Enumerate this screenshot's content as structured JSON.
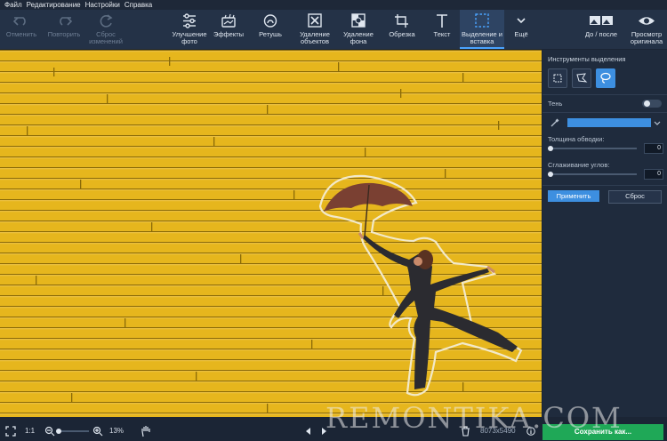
{
  "menu": [
    "Файл",
    "Редактирование",
    "Настройки",
    "Справка"
  ],
  "toolbar": {
    "undo": "Отменить",
    "redo": "Повторить",
    "reset_changes": "Сброс изменений",
    "enhance": "Улучшение фото",
    "effects": "Эффекты",
    "retouch": "Ретушь",
    "remove_objects": "Удаление объектов",
    "remove_bg": "Удаление фона",
    "crop": "Обрезка",
    "text": "Текст",
    "select_paste": "Выделение и вставка",
    "more": "Ещё",
    "before_after": "До / после",
    "view_original": "Просмотр оригинала"
  },
  "panel": {
    "title": "Инструменты выделения",
    "shadow": "Тень",
    "stroke": "Толщина обводки:",
    "stroke_value": "0",
    "smooth": "Сглаживание углов:",
    "smooth_value": "0",
    "apply": "Применить",
    "reset": "Сброс",
    "color": "#3d8fe0"
  },
  "bottom": {
    "fit": "1:1",
    "zoom": "13%",
    "zoom_fraction": 0.13,
    "dimensions": "8073x5490",
    "save": "Сохранить как...",
    "watermark": "REMONTIKA.COM"
  }
}
